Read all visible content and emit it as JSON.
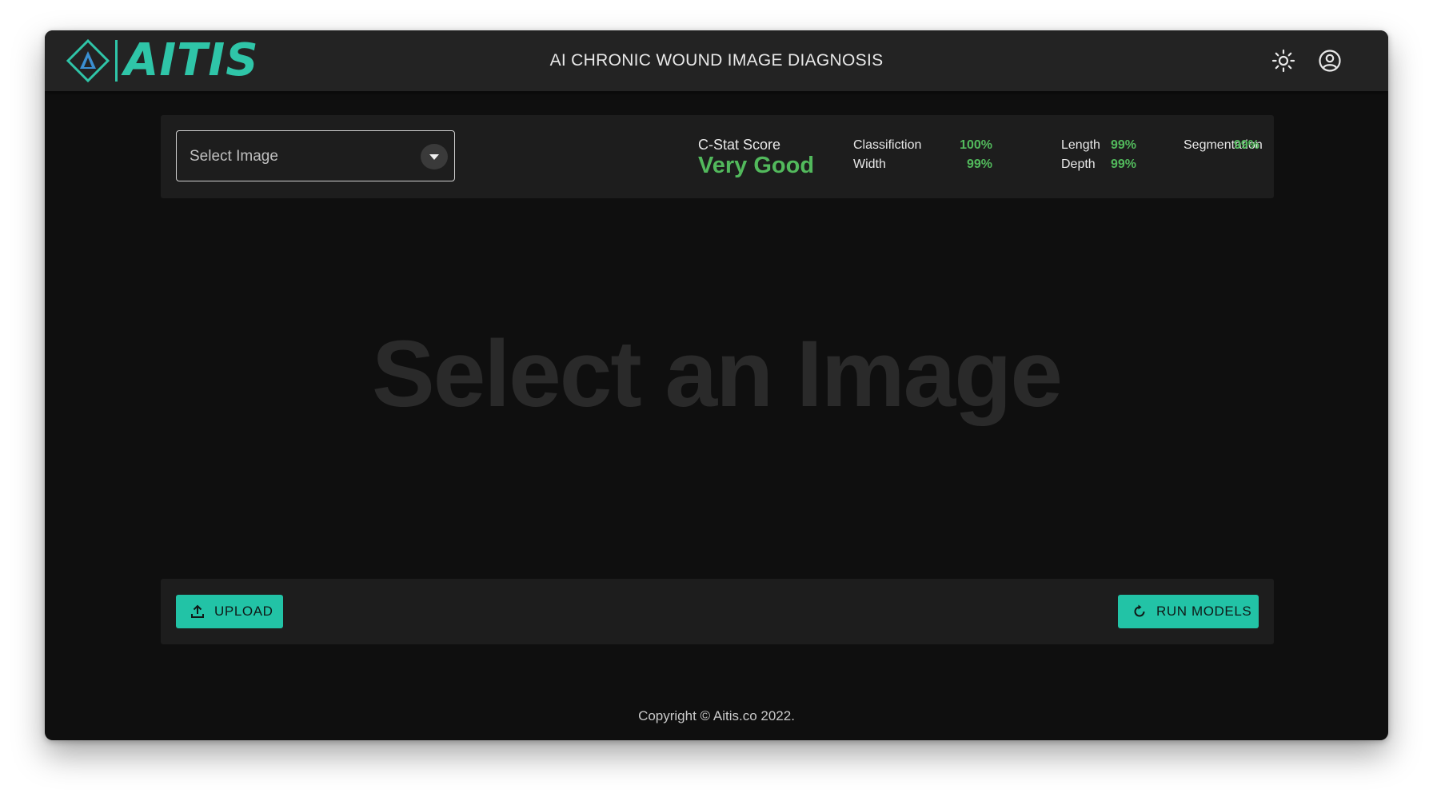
{
  "brand": {
    "name": "AITIS",
    "accent": "#2fc5a8"
  },
  "header": {
    "title": "AI CHRONIC WOUND IMAGE DIAGNOSIS",
    "icons": [
      "sun-icon",
      "account-circle-icon"
    ]
  },
  "image_select": {
    "placeholder": "Select Image"
  },
  "cstat": {
    "label": "C-Stat Score",
    "value": "Very Good",
    "color": "#52b95c"
  },
  "metrics": {
    "classification": {
      "label": "Classifiction",
      "value": "100%"
    },
    "width": {
      "label": "Width",
      "value": "99%"
    },
    "length": {
      "label": "Length",
      "value": "99%"
    },
    "depth": {
      "label": "Depth",
      "value": "99%"
    },
    "segmentation": {
      "label": "Segmentation",
      "value": "99%"
    }
  },
  "main": {
    "empty_message": "Select an Image"
  },
  "actions": {
    "upload_label": "UPLOAD",
    "run_label": "RUN MODELS",
    "button_color": "#22c3a6"
  },
  "footer": {
    "copyright": "Copyright © Aitis.co 2022."
  }
}
